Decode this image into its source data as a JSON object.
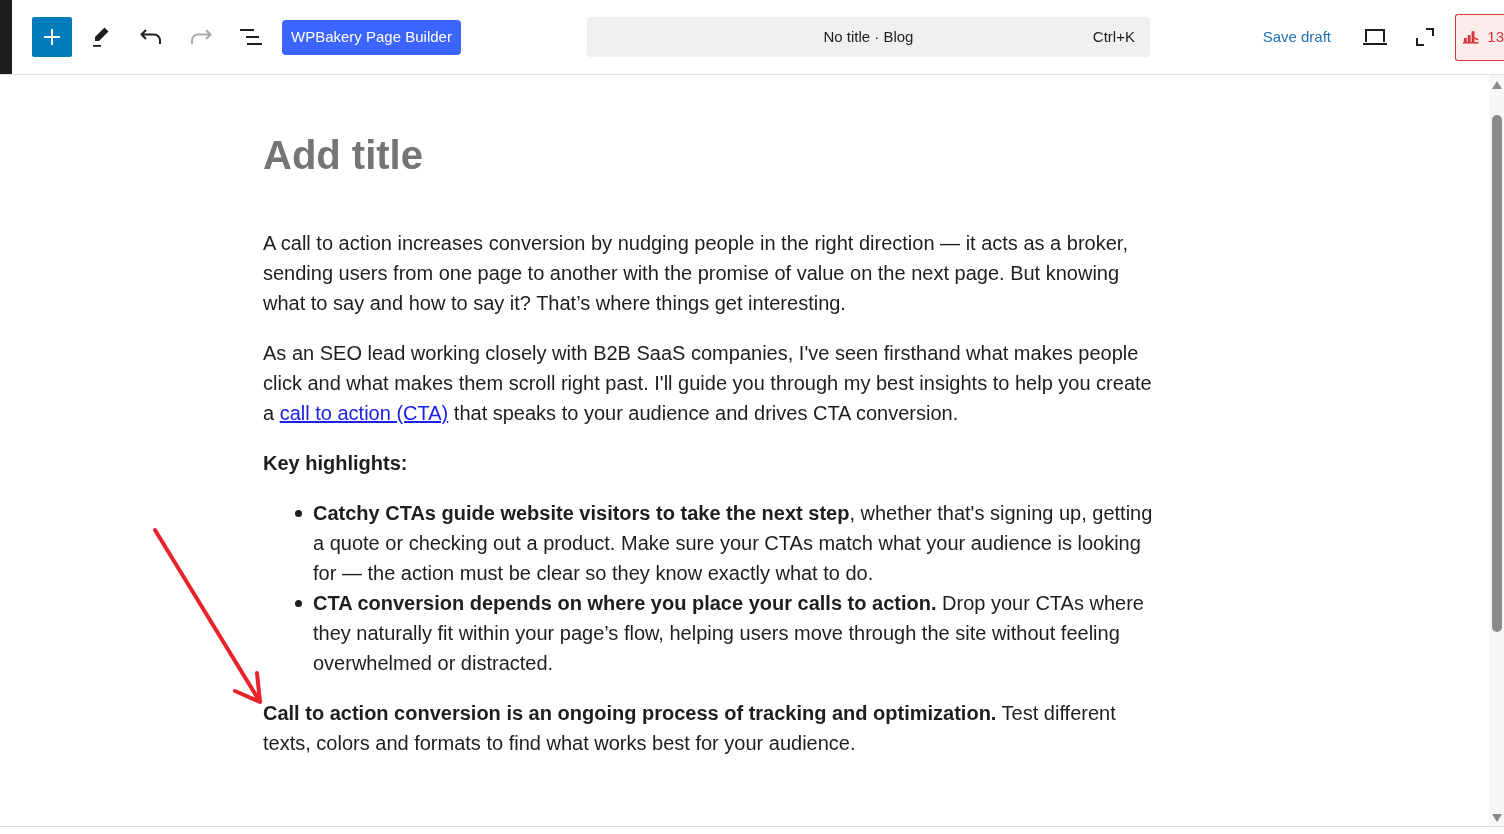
{
  "toolbar": {
    "undo": {
      "disabled": false
    },
    "redo": {
      "disabled": true
    },
    "builder_button": "WPBakery Page Builder",
    "command_bar": {
      "title": "No title · Blog",
      "shortcut": "Ctrl+K"
    },
    "save_draft": "Save draft",
    "seo_badge": {
      "count": "13"
    }
  },
  "editor": {
    "title_field": {
      "placeholder": "Add title"
    },
    "blocks": [
      {
        "kind": "paragraph",
        "bold": false,
        "segments": [
          {
            "kind": "text",
            "text": "A call to action increases conversion by nudging people in the right direction — it acts as a broker, sending users from one page to another with the promise of value on the next page. But knowing what to say and how to say it? That’s where things get interesting."
          }
        ]
      },
      {
        "kind": "paragraph",
        "bold": false,
        "segments": [
          {
            "kind": "text",
            "text": "As an SEO lead working closely with B2B SaaS companies, I've seen firsthand what makes people click and what makes them scroll right past. I'll guide you through my best insights to help you create a"
          },
          {
            "kind": "link",
            "text": "call to action (CTA)"
          },
          {
            "kind": "text",
            "text": "that speaks to your audience and drives CTA conversion."
          }
        ]
      },
      {
        "kind": "paragraph",
        "bold": true,
        "segments": [
          {
            "kind": "text",
            "text": "Key highlights:"
          }
        ]
      },
      {
        "kind": "list",
        "items": [
          "**Catchy CTAs guide website visitors to take the next step**, whether that's signing up, getting a quote or checking out a product. Make sure your CTAs match what your audience is looking for — the action must be clear so they know exactly what to do.",
          "**CTA conversion depends on where you place your calls to action.** Drop your CTAs where they naturally fit within your page’s flow, helping users move through the site without feeling overwhelmed or distracted."
        ]
      },
      {
        "kind": "paragraph",
        "bold": false,
        "segments": [
          {
            "kind": "text",
            "text": "**Call to action conversion is an ongoing process of tracking and optimization.** Test different texts, colors and formats to find what works best for your audience."
          }
        ]
      }
    ]
  }
}
